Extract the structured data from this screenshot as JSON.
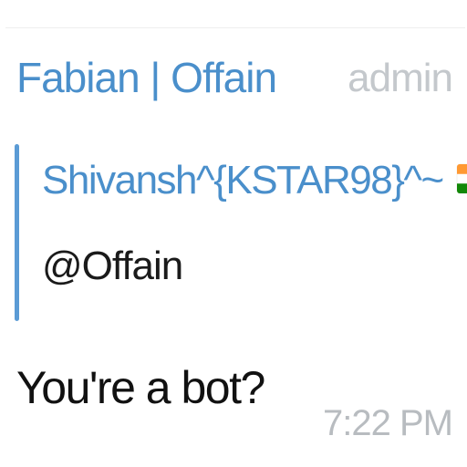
{
  "message": {
    "sender_name": "Fabian | Offain",
    "sender_role": "admin",
    "reply": {
      "author": "Shivansh^{KSTAR98}^~",
      "author_flag": "india-flag-icon",
      "text": "@Offain"
    },
    "text": "You're a bot?",
    "time": "7:22 PM"
  },
  "colors": {
    "sender_name": "#4a8fcb",
    "reply_bar": "#5b9bd5",
    "admin_badge": "#c4c8cc",
    "timestamp": "#b8bcc0",
    "message_text": "#111111",
    "flag_saffron": "#ff9933",
    "flag_white": "#ffffff",
    "flag_green": "#138808",
    "flag_chakra": "#000080"
  }
}
